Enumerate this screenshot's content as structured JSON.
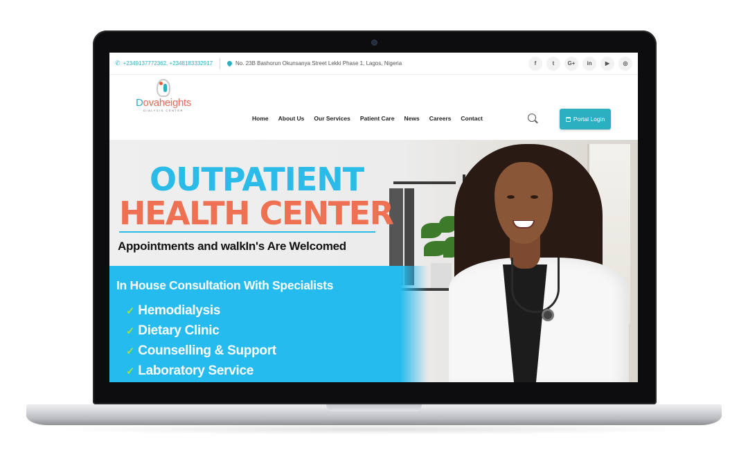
{
  "topbar": {
    "phone": "+2349137772362, +2348183332917",
    "address": "No. 23B Bashorun Okunsanya Street Lekki Phase 1, Lagos, Nigeria",
    "socials": [
      {
        "name": "facebook-icon",
        "glyph": "f"
      },
      {
        "name": "twitter-icon",
        "glyph": "t"
      },
      {
        "name": "google-plus-icon",
        "glyph": "G+"
      },
      {
        "name": "linkedin-icon",
        "glyph": "in"
      },
      {
        "name": "youtube-icon",
        "glyph": "▶"
      },
      {
        "name": "instagram-icon",
        "glyph": "◎"
      }
    ]
  },
  "logo": {
    "name_prefix": "D",
    "name_rest": "ovaheights",
    "tagline": "DIALYSIS CENTER"
  },
  "nav": {
    "items": [
      "Home",
      "About Us",
      "Our Services",
      "Patient Care",
      "News",
      "Careers",
      "Contact"
    ]
  },
  "header": {
    "portal_label": "Portal Login"
  },
  "hero": {
    "line1": "OUTPATIENT",
    "line2": "HEALTH CENTER",
    "line3": "Appointments and walkIn's Are Welcomed",
    "consult_title": "In House Consultation With Specialists",
    "services": [
      "Hemodialysis",
      "Dietary Clinic",
      "Counselling & Support",
      "Laboratory Service"
    ],
    "check_glyph": "✓"
  },
  "colors": {
    "accent": "#2bb0c2",
    "hero_blue": "#26bbee",
    "hero_orange": "#ef7153",
    "check_green": "#9ee24a"
  }
}
